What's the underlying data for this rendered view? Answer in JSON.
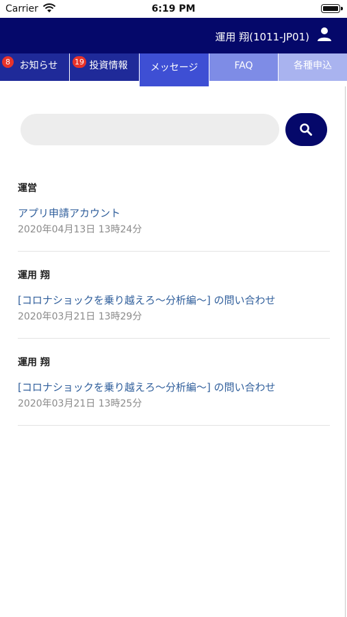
{
  "status_bar": {
    "carrier": "Carrier",
    "time": "6:19 PM"
  },
  "header": {
    "user_name": "運用 翔(1011-JP01)",
    "bg_color": "#05086a"
  },
  "tabs": [
    {
      "label": "お知らせ",
      "badge": "8",
      "active": false
    },
    {
      "label": "投資情報",
      "badge": "19",
      "active": false
    },
    {
      "label": "メッセージ",
      "badge": "",
      "active": true
    },
    {
      "label": "FAQ",
      "badge": "",
      "active": false
    },
    {
      "label": "各種申込",
      "badge": "",
      "active": false
    }
  ],
  "search": {
    "value": "",
    "placeholder": ""
  },
  "messages": [
    {
      "sender": "運営",
      "subject": "アプリ申請アカウント",
      "date": "2020年04月13日 13時24分"
    },
    {
      "sender": "運用 翔",
      "subject": "[コロナショックを乗り越えろ～分析編～] の問い合わせ",
      "date": "2020年03月21日 13時29分"
    },
    {
      "sender": "運用 翔",
      "subject": "[コロナショックを乗り越えろ～分析編～] の問い合わせ",
      "date": "2020年03月21日 13時25分"
    }
  ],
  "colors": {
    "accent": "#05086a",
    "link": "#2f5e9b",
    "badge": "#e8332a"
  }
}
